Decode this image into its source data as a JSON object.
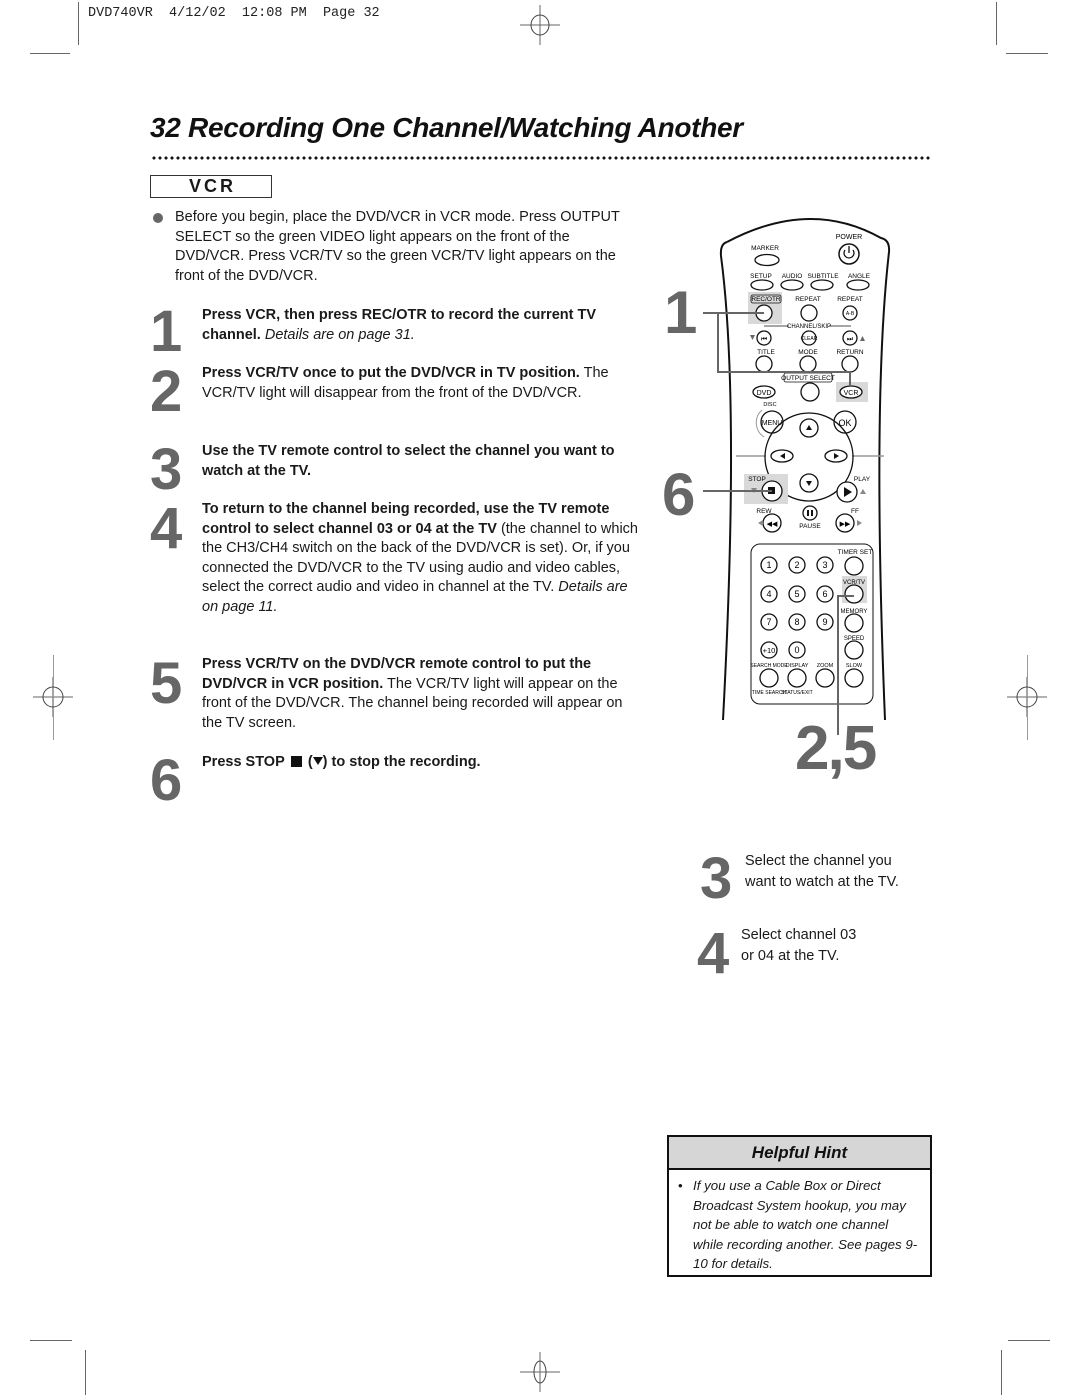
{
  "slug": "DVD740VR  4/12/02  12:08 PM  Page 32",
  "header": {
    "title": "32  Recording One Channel/Watching Another",
    "section_badge": "VCR"
  },
  "intro": "Before you begin, place the DVD/VCR in VCR mode. Press OUTPUT SELECT so the green VIDEO light appears on the front of the DVD/VCR. Press VCR/TV so the green VCR/TV light appears on the front of the DVD/VCR.",
  "steps": [
    {
      "num": "1",
      "bold": "Press VCR, then press REC/OTR to record the current TV channel.",
      "normal": "",
      "italic": "Details are on page 31."
    },
    {
      "num": "2",
      "bold": "Press VCR/TV once to put the DVD/VCR in TV position.",
      "normal": "The VCR/TV light will disappear from the front of the DVD/VCR.",
      "italic": ""
    },
    {
      "num": "3",
      "bold": "Use the TV remote control to select the channel you want to watch at the TV.",
      "normal": "",
      "italic": ""
    },
    {
      "num": "4",
      "bold": "To return to the channel being recorded, use the TV remote control to select channel 03 or 04 at the TV",
      "normal": "(the channel to which the CH3/CH4 switch on the back of the DVD/VCR is set). Or, if you connected the DVD/VCR to the TV using audio and video cables, select the correct audio and video in channel at the TV.",
      "italic": "Details are on page 11."
    },
    {
      "num": "5",
      "bold": "Press VCR/TV on the DVD/VCR remote control to put the DVD/VCR in VCR position.",
      "normal": "The VCR/TV light will appear on the front of the DVD/VCR. The channel being recorded will appear on the TV screen.",
      "italic": ""
    },
    {
      "num": "6",
      "bold_before": "Press STOP",
      "bold_after": "to stop the recording.",
      "icons": [
        "stop-square-icon",
        "down-triangle-icon"
      ]
    }
  ],
  "remote": {
    "callouts": {
      "step1": "1",
      "step6": "6",
      "step25": "2,5"
    },
    "labels": {
      "power": "POWER",
      "marker": "MARKER",
      "setup": "SETUP",
      "audio": "AUDIO",
      "subtitle": "SUBTITLE",
      "angle": "ANGLE",
      "rec_otr": "REC/OTR",
      "repeat": "REPEAT",
      "repeat_ab": "REPEAT",
      "ab": "A-B",
      "channel_skip": "CHANNEL/SKIP",
      "clear": "CLEAR",
      "title": "TITLE",
      "mode": "MODE",
      "return": "RETURN",
      "output_select": "OUTPUT SELECT",
      "dvd": "DVD",
      "vcr": "VCR",
      "disc": "DISC",
      "menu": "MENU",
      "ok": "OK",
      "stop": "STOP",
      "play": "PLAY",
      "rew": "REW",
      "ff": "FF",
      "pause": "PAUSE",
      "timer_set": "TIMER SET",
      "vcr_tv": "VCR/TV",
      "memory": "MEMORY",
      "speed": "SPEED",
      "search_mode": "SEARCH MODE",
      "display": "DISPLAY",
      "zoom": "ZOOM",
      "slow": "SLOW",
      "time_search": "TIME SEARCH",
      "status_exit": "STATUS/EXIT",
      "digits": [
        "1",
        "2",
        "3",
        "4",
        "5",
        "6",
        "7",
        "8",
        "9",
        "+10",
        "0"
      ]
    }
  },
  "side_notes": [
    {
      "num": "3",
      "text_line1": "Select the channel you",
      "text_line2": "want to watch at the TV."
    },
    {
      "num": "4",
      "text_line1": "Select channel 03",
      "text_line2": "or 04 at the TV."
    }
  ],
  "hint": {
    "title": "Helpful Hint",
    "bullet": "•",
    "text": "If you use a Cable Box or Direct Broadcast System hookup, you may not be able to watch one channel while recording another. See pages 9-10 for details."
  }
}
